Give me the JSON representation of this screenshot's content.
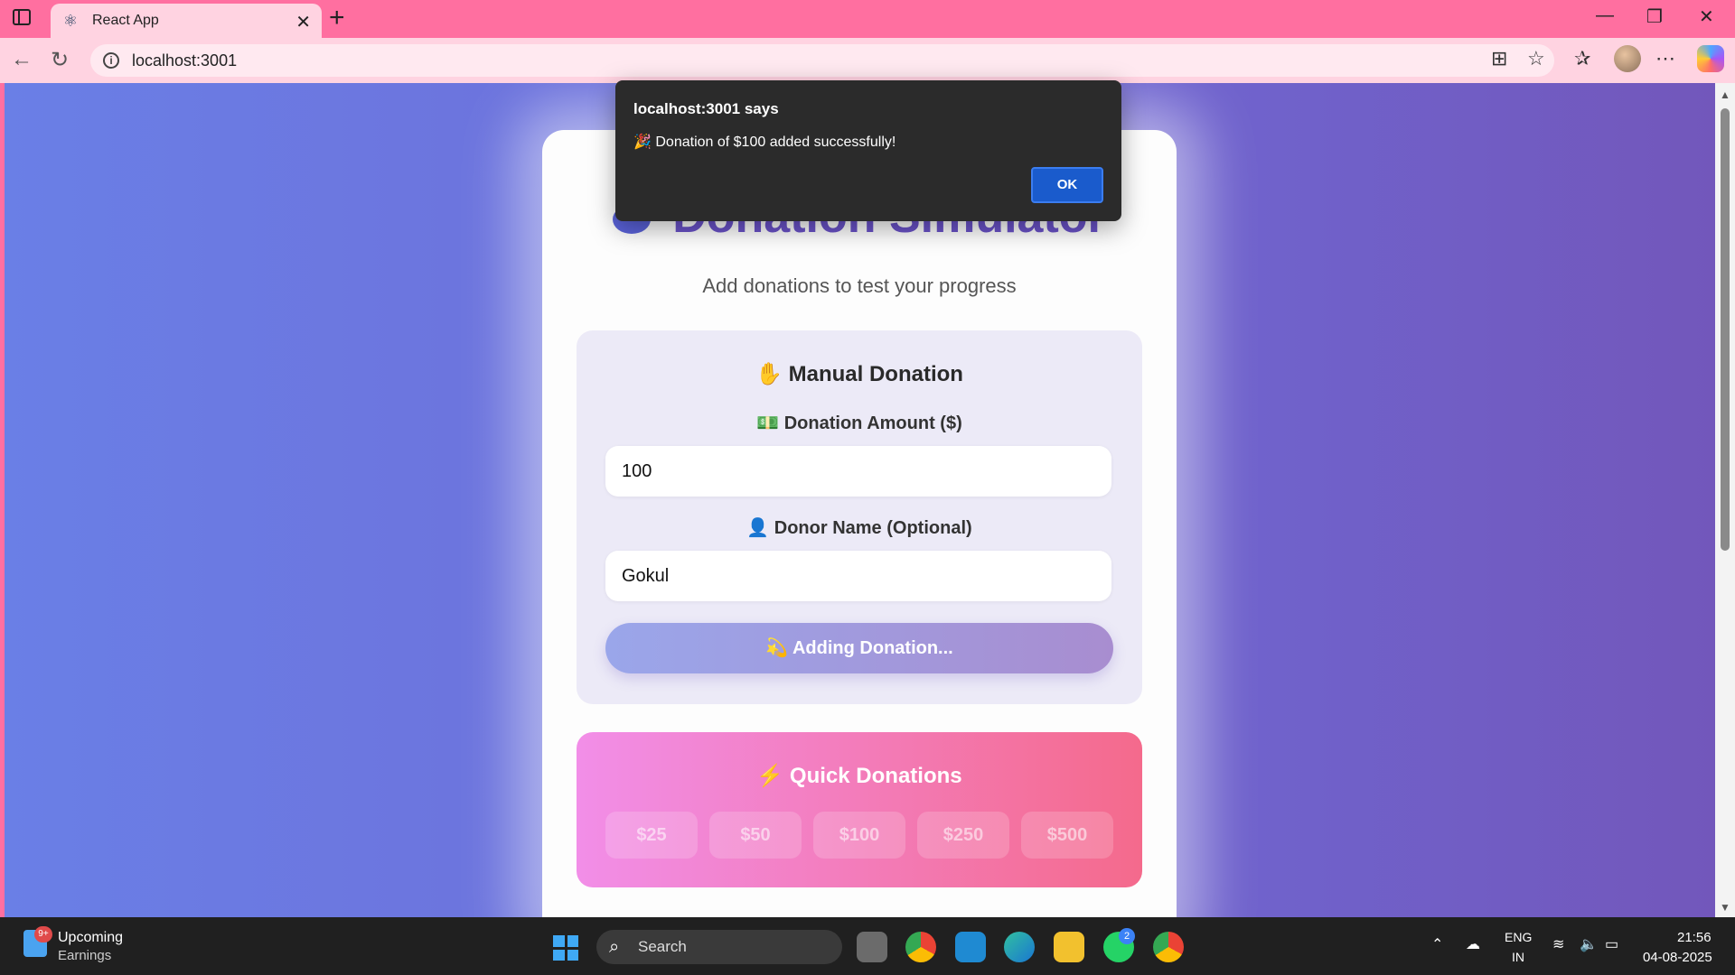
{
  "browser": {
    "tab_title": "React App",
    "url": "localhost:3001"
  },
  "page": {
    "title": "Donation Simulator",
    "subtitle": "Add donations to test your progress",
    "manual": {
      "title": "✋ Manual Donation",
      "amount_label": "💵 Donation Amount ($)",
      "amount_value": "100",
      "donor_label": "👤 Donor Name (Optional)",
      "donor_value": "Gokul",
      "submit_label": "💫 Adding Donation..."
    },
    "quick": {
      "title": "⚡ Quick Donations",
      "amounts": [
        "$25",
        "$50",
        "$100",
        "$250",
        "$500"
      ]
    }
  },
  "dialog": {
    "title": "localhost:3001 says",
    "message": "🎉 Donation of $100 added successfully!",
    "ok_label": "OK"
  },
  "taskbar": {
    "widget_line1": "Upcoming",
    "widget_line2": "Earnings",
    "widget_badge": "9+",
    "search_label": "Search",
    "lang_line1": "ENG",
    "lang_line2": "IN",
    "time": "21:56",
    "date": "04-08-2025",
    "whatsapp_badge": "2"
  },
  "colors": {
    "accent": "#6a52c9",
    "tab_strip": "#ff6fa0",
    "dialog_ok": "#1a5bcc"
  }
}
